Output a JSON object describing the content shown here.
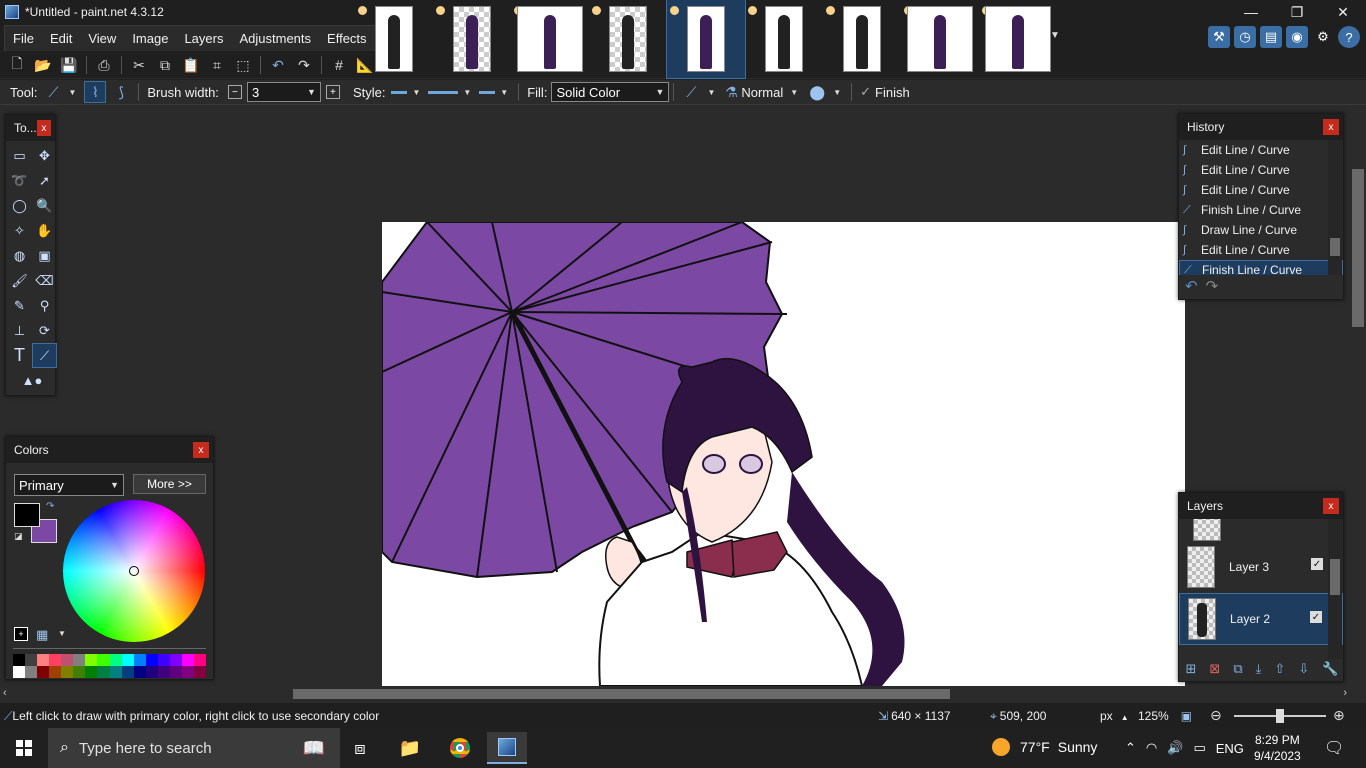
{
  "window": {
    "title": "*Untitled - paint.net 4.3.12",
    "controls": {
      "minimize": "—",
      "restore": "❐",
      "close": "✕"
    }
  },
  "menu": [
    "File",
    "Edit",
    "View",
    "Image",
    "Layers",
    "Adjustments",
    "Effects"
  ],
  "toolbar": {
    "tool_label": "Tool:",
    "brush_width_label": "Brush width:",
    "brush_width_value": "3",
    "style_label": "Style:",
    "fill_label": "Fill:",
    "fill_value": "Solid Color",
    "blend_mode": "Normal",
    "finish_label": "Finish"
  },
  "tools_window": {
    "title": "To..."
  },
  "colors_window": {
    "title": "Colors",
    "mode": "Primary",
    "more_button": "More >>",
    "primary_color": "#000000",
    "secondary_color": "#7b49a4",
    "palette_row1": [
      "#000000",
      "#404040",
      "#ff8080",
      "#ff4060",
      "#c05070",
      "#808080",
      "#80ff00",
      "#40ff00",
      "#00ff80",
      "#00ffff",
      "#0080ff",
      "#0000ff",
      "#4000ff",
      "#8000ff",
      "#ff00ff",
      "#ff0080"
    ],
    "palette_row2": [
      "#ffffff",
      "#808080",
      "#800000",
      "#a04000",
      "#808000",
      "#408000",
      "#008000",
      "#008040",
      "#008080",
      "#004080",
      "#000080",
      "#200080",
      "#400080",
      "#600080",
      "#800080",
      "#800040"
    ]
  },
  "history_window": {
    "title": "History",
    "items": [
      {
        "label": "Edit Line / Curve",
        "selected": false
      },
      {
        "label": "Edit Line / Curve",
        "selected": false
      },
      {
        "label": "Edit Line / Curve",
        "selected": false
      },
      {
        "label": "Finish Line / Curve",
        "selected": false
      },
      {
        "label": "Draw Line / Curve",
        "selected": false
      },
      {
        "label": "Edit Line / Curve",
        "selected": false
      },
      {
        "label": "Finish Line / Curve",
        "selected": true
      }
    ]
  },
  "layers_window": {
    "title": "Layers",
    "layers": [
      {
        "name": "Layer 3",
        "visible": true,
        "selected": false
      },
      {
        "name": "Layer 2",
        "visible": true,
        "selected": true
      }
    ]
  },
  "status": {
    "hint": "Left click to draw with primary color, right click to use secondary color",
    "image_size": "640 × 1137",
    "cursor_pos": "509, 200",
    "unit": "px",
    "zoom": "125%"
  },
  "taskbar": {
    "search_placeholder": "Type here to search",
    "weather_temp": "77°F",
    "weather_desc": "Sunny",
    "language": "ENG",
    "time": "8:29 PM",
    "date": "9/4/2023"
  },
  "icons": {
    "umbrella_color": "#7b49a4",
    "hair_color": "#2e1240"
  }
}
